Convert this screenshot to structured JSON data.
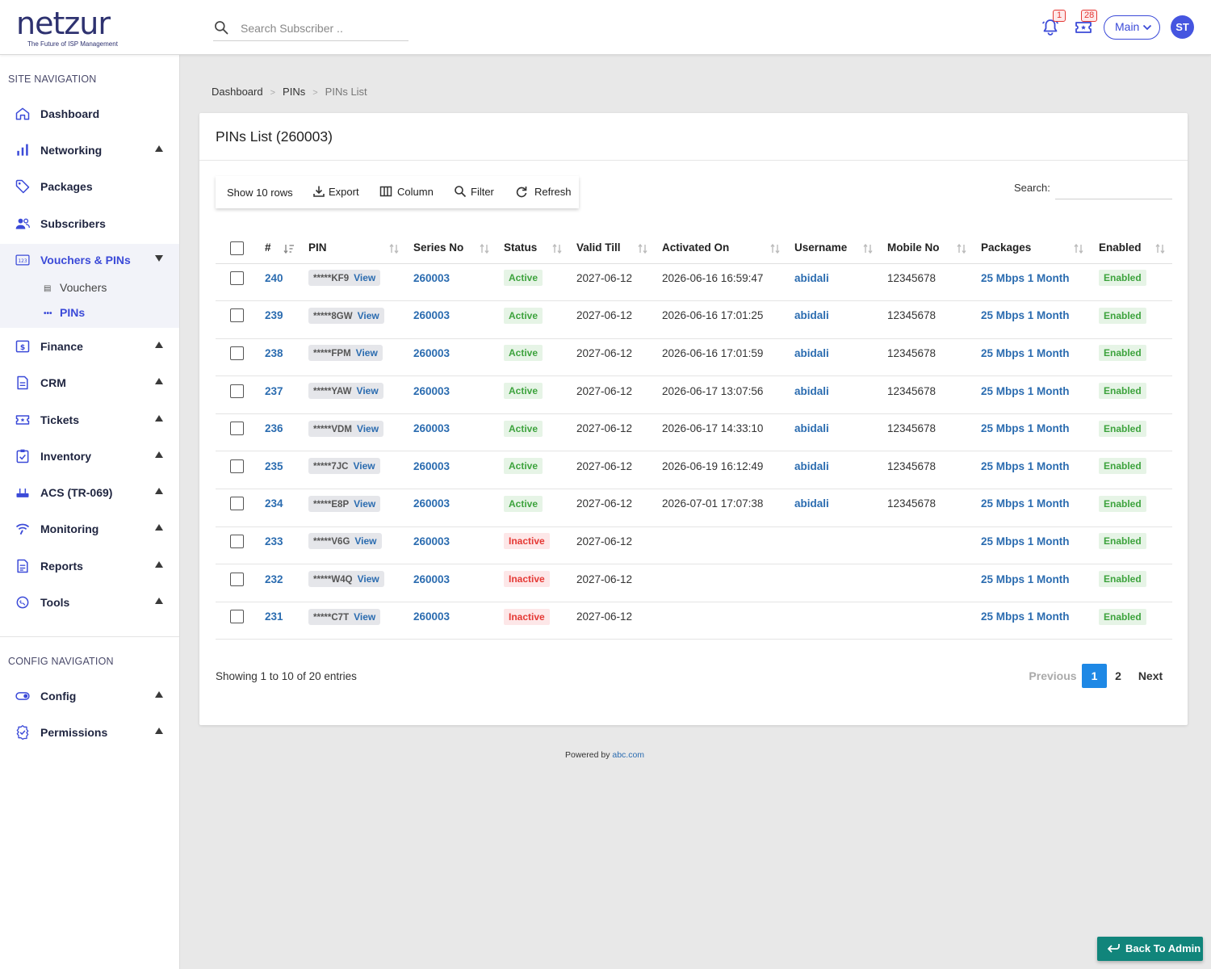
{
  "brand": {
    "name": "netzur",
    "tagline": "The Future of ISP Management",
    "accent": "#3b4ad8",
    "dot_color": "#f27c22"
  },
  "header": {
    "search_placeholder": "Search Subscriber ..",
    "notifications_count": "1",
    "tickets_count": "28",
    "branch_select": "Main",
    "avatar_initials": "ST"
  },
  "sidebar": {
    "site_section": "SITE NAVIGATION",
    "config_section": "CONFIG NAVIGATION",
    "items": [
      {
        "label": "Dashboard",
        "icon": "home-icon"
      },
      {
        "label": "Networking",
        "icon": "bar-chart-icon"
      },
      {
        "label": "Packages",
        "icon": "tag-icon"
      },
      {
        "label": "Subscribers",
        "icon": "users-icon"
      },
      {
        "label": "Vouchers & PINs",
        "icon": "pin-123-icon"
      },
      {
        "label": "Finance",
        "icon": "dollar-icon"
      },
      {
        "label": "CRM",
        "icon": "document-icon"
      },
      {
        "label": "Tickets",
        "icon": "ticket-icon"
      },
      {
        "label": "Inventory",
        "icon": "clipboard-icon"
      },
      {
        "label": "ACS (TR-069)",
        "icon": "router-icon"
      },
      {
        "label": "Monitoring",
        "icon": "signal-icon"
      },
      {
        "label": "Reports",
        "icon": "report-icon"
      },
      {
        "label": "Tools",
        "icon": "wrench-icon"
      }
    ],
    "sub_items": [
      {
        "label": "Vouchers"
      },
      {
        "label": "PINs"
      }
    ],
    "config_items": [
      {
        "label": "Config",
        "icon": "toggle-icon"
      },
      {
        "label": "Permissions",
        "icon": "badge-check-icon"
      }
    ]
  },
  "breadcrumb": {
    "items": [
      "Dashboard",
      "PINs"
    ],
    "current": "PINs List",
    "separator": ">"
  },
  "card": {
    "title": "PINs List (260003)"
  },
  "toolbar": {
    "show_rows": "Show 10 rows",
    "export": "Export",
    "column": "Column",
    "filter": "Filter",
    "refresh": "Refresh",
    "search_label": "Search:"
  },
  "table": {
    "columns": [
      "#",
      "PIN",
      "Series No",
      "Status",
      "Valid Till",
      "Activated On",
      "Username",
      "Mobile No",
      "Packages",
      "Enabled"
    ],
    "view_label": "View",
    "rows": [
      {
        "id": "240",
        "pin": "*****KF9",
        "series": "260003",
        "status": "Active",
        "valid_till": "2027-06-12",
        "activated_on": "2026-06-16 16:59:47",
        "username": "abidali",
        "mobile": "12345678",
        "package": "25 Mbps 1 Month",
        "enabled": "Enabled"
      },
      {
        "id": "239",
        "pin": "*****8GW",
        "series": "260003",
        "status": "Active",
        "valid_till": "2027-06-12",
        "activated_on": "2026-06-16 17:01:25",
        "username": "abidali",
        "mobile": "12345678",
        "package": "25 Mbps 1 Month",
        "enabled": "Enabled"
      },
      {
        "id": "238",
        "pin": "*****FPM",
        "series": "260003",
        "status": "Active",
        "valid_till": "2027-06-12",
        "activated_on": "2026-06-16 17:01:59",
        "username": "abidali",
        "mobile": "12345678",
        "package": "25 Mbps 1 Month",
        "enabled": "Enabled"
      },
      {
        "id": "237",
        "pin": "*****YAW",
        "series": "260003",
        "status": "Active",
        "valid_till": "2027-06-12",
        "activated_on": "2026-06-17 13:07:56",
        "username": "abidali",
        "mobile": "12345678",
        "package": "25 Mbps 1 Month",
        "enabled": "Enabled"
      },
      {
        "id": "236",
        "pin": "*****VDM",
        "series": "260003",
        "status": "Active",
        "valid_till": "2027-06-12",
        "activated_on": "2026-06-17 14:33:10",
        "username": "abidali",
        "mobile": "12345678",
        "package": "25 Mbps 1 Month",
        "enabled": "Enabled"
      },
      {
        "id": "235",
        "pin": "*****7JC",
        "series": "260003",
        "status": "Active",
        "valid_till": "2027-06-12",
        "activated_on": "2026-06-19 16:12:49",
        "username": "abidali",
        "mobile": "12345678",
        "package": "25 Mbps 1 Month",
        "enabled": "Enabled"
      },
      {
        "id": "234",
        "pin": "*****E8P",
        "series": "260003",
        "status": "Active",
        "valid_till": "2027-06-12",
        "activated_on": "2026-07-01 17:07:38",
        "username": "abidali",
        "mobile": "12345678",
        "package": "25 Mbps 1 Month",
        "enabled": "Enabled"
      },
      {
        "id": "233",
        "pin": "*****V6G",
        "series": "260003",
        "status": "Inactive",
        "valid_till": "2027-06-12",
        "activated_on": "",
        "username": "",
        "mobile": "",
        "package": "25 Mbps 1 Month",
        "enabled": "Enabled"
      },
      {
        "id": "232",
        "pin": "*****W4Q",
        "series": "260003",
        "status": "Inactive",
        "valid_till": "2027-06-12",
        "activated_on": "",
        "username": "",
        "mobile": "",
        "package": "25 Mbps 1 Month",
        "enabled": "Enabled"
      },
      {
        "id": "231",
        "pin": "*****C7T",
        "series": "260003",
        "status": "Inactive",
        "valid_till": "2027-06-12",
        "activated_on": "",
        "username": "",
        "mobile": "",
        "package": "25 Mbps 1 Month",
        "enabled": "Enabled"
      }
    ]
  },
  "pagination": {
    "info": "Showing 1 to 10 of 20 entries",
    "previous": "Previous",
    "pages": [
      "1",
      "2"
    ],
    "current": "1",
    "next": "Next"
  },
  "footer": {
    "text": "Powered by",
    "link": "abc.com"
  },
  "floating": {
    "back_to_admin": "Back To Admin"
  }
}
